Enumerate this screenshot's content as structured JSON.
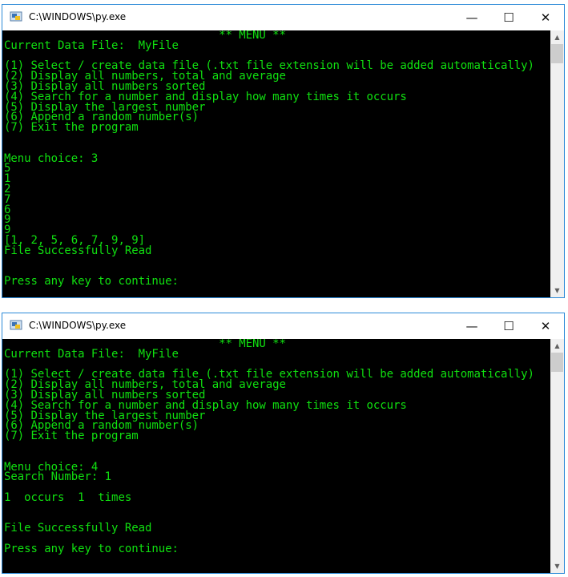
{
  "windows": [
    {
      "title": "C:\\WINDOWS\\py.exe",
      "controls": {
        "minimize": "—",
        "maximize": "☐",
        "close": "✕"
      },
      "lines": [
        "                                ** MENU **",
        "Current Data File:  MyFile",
        "",
        "(1) Select / create data file (.txt file extension will be added automatically)",
        "(2) Display all numbers, total and average",
        "(3) Display all numbers sorted",
        "(4) Search for a number and display how many times it occurs",
        "(5) Display the largest number",
        "(6) Append a random number(s)",
        "(7) Exit the program",
        "",
        "",
        "Menu choice: 3",
        "5",
        "1",
        "2",
        "7",
        "6",
        "9",
        "9",
        "[1, 2, 5, 6, 7, 9, 9]",
        "File Successfully Read",
        "",
        "",
        "Press any key to continue:"
      ]
    },
    {
      "title": "C:\\WINDOWS\\py.exe",
      "controls": {
        "minimize": "—",
        "maximize": "☐",
        "close": "✕"
      },
      "lines": [
        "                                ** MENU **",
        "Current Data File:  MyFile",
        "",
        "(1) Select / create data file (.txt file extension will be added automatically)",
        "(2) Display all numbers, total and average",
        "(3) Display all numbers sorted",
        "(4) Search for a number and display how many times it occurs",
        "(5) Display the largest number",
        "(6) Append a random number(s)",
        "(7) Exit the program",
        "",
        "",
        "Menu choice: 4",
        "Search Number: 1",
        "",
        "1  occurs  1  times",
        "",
        "",
        "File Successfully Read",
        "",
        "Press any key to continue:"
      ]
    }
  ],
  "scrollbar": {
    "up": "▲",
    "down": "▼"
  },
  "colors": {
    "console_bg": "#000000",
    "console_text": "#10e010",
    "border": "#2b8ad8"
  }
}
